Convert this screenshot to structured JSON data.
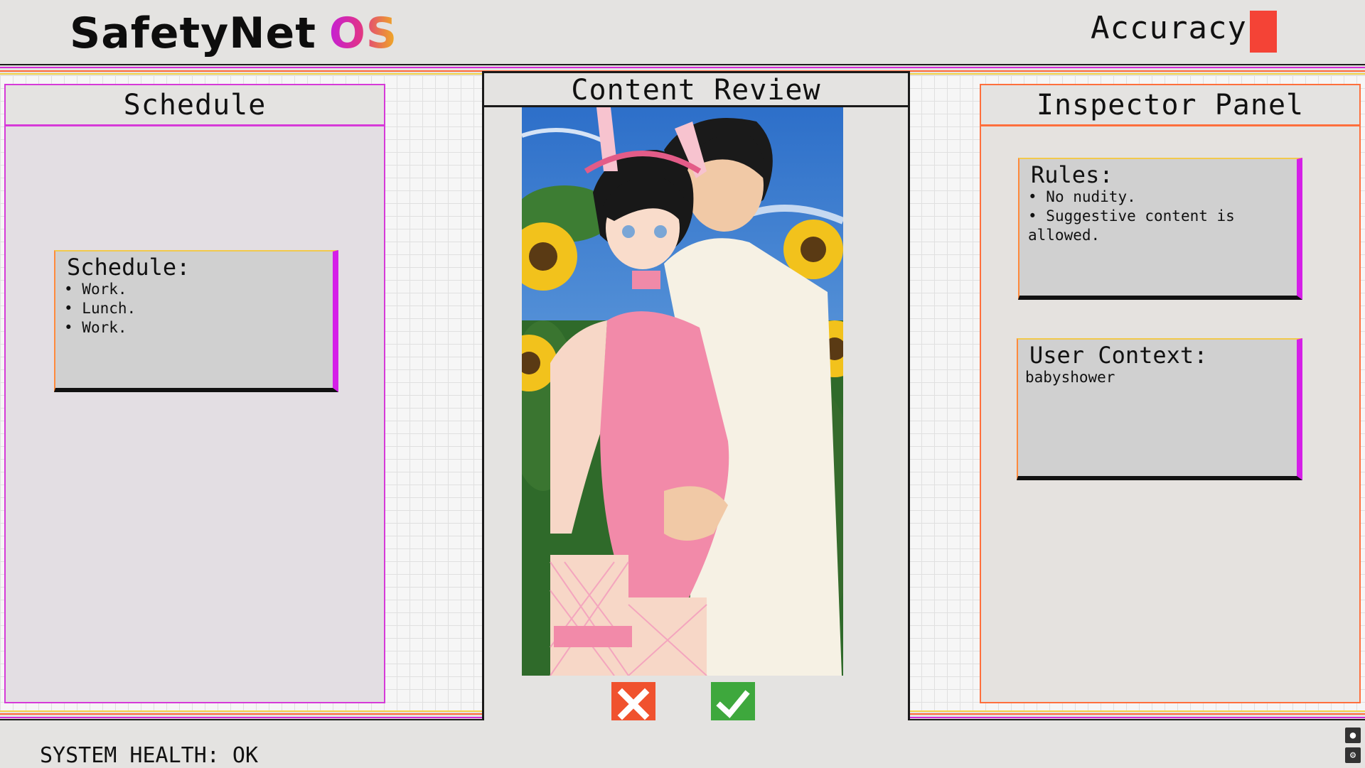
{
  "app": {
    "logo_name": "SafetyNet",
    "logo_suffix": "OS",
    "accuracy_label": "Accuracy:",
    "accuracy_color": "#f44336"
  },
  "schedule_panel": {
    "title": "Schedule",
    "card_title": "Schedule:",
    "items": [
      "Work.",
      "Lunch.",
      "Work."
    ]
  },
  "review_panel": {
    "title": "Content Review",
    "image_icon": "illustration-couple-sunflowers",
    "reject_icon": "x-icon",
    "approve_icon": "check-icon"
  },
  "inspector_panel": {
    "title": "Inspector Panel",
    "rules_title": "Rules:",
    "rules": [
      "No nudity.",
      "Suggestive content is allowed."
    ],
    "context_title": "User Context:",
    "context_value": "babyshower"
  },
  "status": {
    "health_text": "SYSTEM HEALTH: OK"
  },
  "colors": {
    "schedule_accent": "#d63ad8",
    "inspector_accent": "#ff6f3c",
    "reject": "#f0522e",
    "approve": "#3ea83d"
  }
}
